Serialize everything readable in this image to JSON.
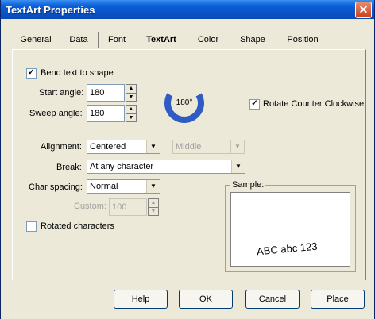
{
  "window": {
    "title": "TextArt Properties",
    "close_glyph": "✕"
  },
  "tabs": [
    "General",
    "Data",
    "Font",
    "TextArt",
    "Color",
    "Shape",
    "Position"
  ],
  "bend": {
    "label": "Bend text to shape",
    "checked_glyph": "✓"
  },
  "start_angle": {
    "label": "Start angle:",
    "value": "180"
  },
  "sweep_angle": {
    "label": "Sweep angle:",
    "value": "180"
  },
  "dial": {
    "value": "180°"
  },
  "rotate_ccw": {
    "label": "Rotate Counter Clockwise",
    "checked_glyph": "✓"
  },
  "alignment": {
    "label": "Alignment:",
    "value": "Centered",
    "vertical_value": "Middle"
  },
  "break": {
    "label": "Break:",
    "value": "At any character"
  },
  "char_spacing": {
    "label": "Char spacing:",
    "value": "Normal"
  },
  "custom": {
    "label": "Custom:",
    "value": "100"
  },
  "rotated_chars": {
    "label": "Rotated characters"
  },
  "sample": {
    "label": "Sample:",
    "text": "ABC abc 123"
  },
  "buttons": {
    "help": "Help",
    "ok": "OK",
    "cancel": "Cancel",
    "place": "Place"
  },
  "glyphs": {
    "up": "▲",
    "down": "▼",
    "dropdown": "▼"
  }
}
